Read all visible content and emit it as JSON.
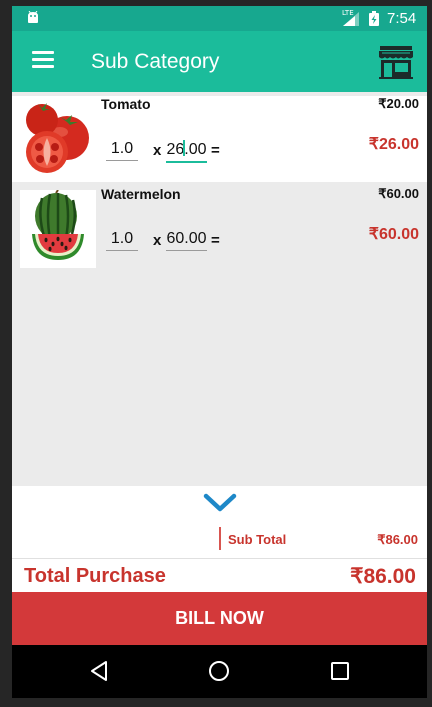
{
  "statusbar": {
    "network": "LTE",
    "time": "7:54"
  },
  "toolbar": {
    "title": "Sub Category",
    "menu_icon": "hamburger-menu-icon",
    "store_icon": "store-icon"
  },
  "items": [
    {
      "name": "Tomato",
      "price": "₹20.00",
      "quantity": "1.0",
      "times": "x",
      "rate_before_cursor": "26",
      "rate_after_cursor": ".00",
      "equals": "=",
      "total": "₹26.00"
    },
    {
      "name": "Watermelon",
      "price": "₹60.00",
      "quantity": "1.0",
      "times": "x",
      "rate": "60.00",
      "equals": "=",
      "total": "₹60.00"
    }
  ],
  "summary": {
    "subtotal_label": "Sub Total",
    "subtotal_value": "₹86.00",
    "total_label": "Total Purchase",
    "total_value": "₹86.00"
  },
  "bill_button": "BILL NOW",
  "colors": {
    "primary": "#1bbc9b",
    "status_bar": "#17a88f",
    "accent_red": "#c8342d",
    "button_red": "#d3393a"
  }
}
